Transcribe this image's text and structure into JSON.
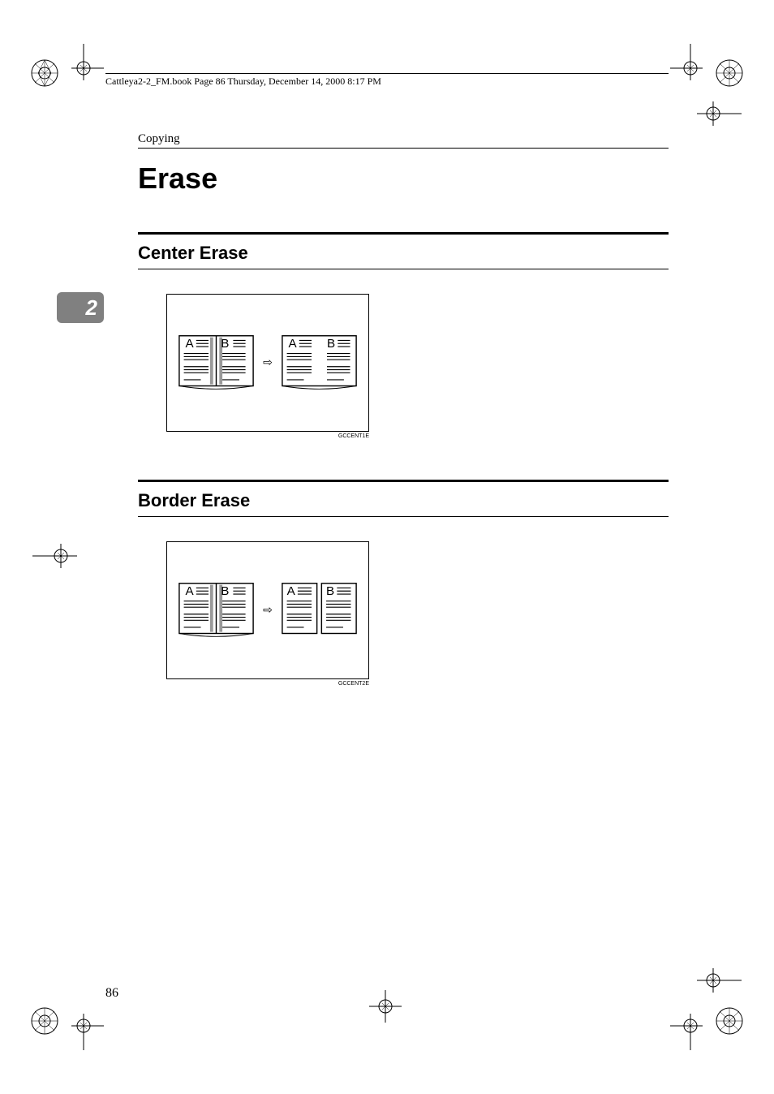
{
  "running_header": "Cattleya2-2_FM.book  Page 86  Thursday, December 14, 2000  8:17 PM",
  "section": "Copying",
  "title": "Erase",
  "chapter_number": "2",
  "subsections": [
    {
      "title": "Center Erase",
      "figure_id": "GCCENT1E",
      "page_labels": [
        "A",
        "B"
      ]
    },
    {
      "title": "Border Erase",
      "figure_id": "GCCENT2E",
      "page_labels": [
        "A",
        "B"
      ]
    }
  ],
  "page_number": "86",
  "arrow_glyph": "⇨"
}
